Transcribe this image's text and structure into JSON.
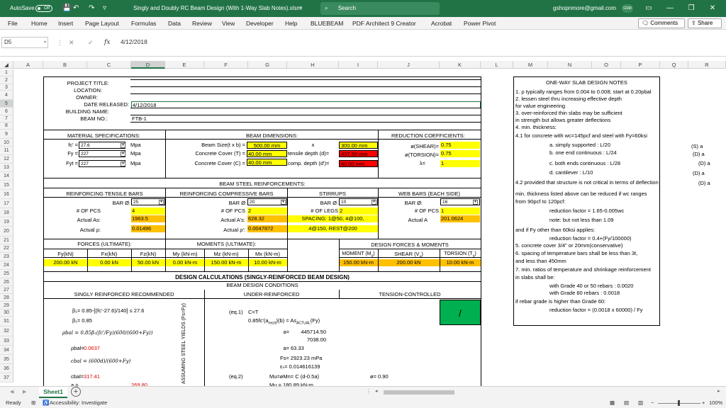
{
  "titlebar": {
    "autosave": "AutoSave",
    "toggle": "Off",
    "filename": "Singly and Doubly RC Beam Design (With 1-Way Slab Notes).xlsm",
    "search": "Search",
    "email": "gshopnmore@gmail.com",
    "avatar": "GSM"
  },
  "menu": {
    "tabs": [
      "File",
      "Home",
      "Insert",
      "Page Layout",
      "Formulas",
      "Data",
      "Review",
      "View",
      "Developer",
      "Help",
      "BLUEBEAM",
      "PDF Architect 9 Creator",
      "Acrobat",
      "Power Pivot"
    ],
    "comments": "Comments",
    "share": "Share"
  },
  "formula": {
    "namebox": "D5",
    "value": "4/12/2018"
  },
  "columns": [
    "A",
    "B",
    "C",
    "D",
    "E",
    "F",
    "G",
    "H",
    "I",
    "J",
    "K",
    "L",
    "M",
    "N",
    "O",
    "P",
    "Q",
    "R"
  ],
  "rows": [
    "1",
    "2",
    "3",
    "4",
    "5",
    "6",
    "7",
    "8",
    "9",
    "10",
    "11",
    "12",
    "13",
    "14",
    "15",
    "16",
    "17",
    "18",
    "19",
    "20",
    "21",
    "22",
    "23",
    "24",
    "25",
    "26",
    "27",
    "28",
    "29",
    "30",
    "31",
    "32",
    "33",
    "34",
    "35",
    "36",
    "37"
  ],
  "project": {
    "title": "PROJECT TITLE:",
    "location": "LOCATION:",
    "owner": "OWNER:",
    "date_label": "DATE RELEASED:",
    "date": "4/12/2018",
    "building": "BUILDING NAME:",
    "beam_label": "BEAM NO.:",
    "beam": "FTB-1"
  },
  "material": {
    "header": "MATERIAL SPECIFICATIONS:",
    "fc_label": "fc' =",
    "fc": "27.6",
    "fy_label": "Fy =",
    "fy": "227",
    "fyt_label": "Fyt =",
    "fyt": "227",
    "unit": "Mpa"
  },
  "dims": {
    "header": "BEAM DIMENSIONS:",
    "size_label": "Beam Size(t x b) =",
    "t": "500.00 mm",
    "x": "x",
    "b": "300.00 mm",
    "cover_t_label": "Concrete Cover (T) =",
    "cover_t": "40.00 mm",
    "d_label": "tensile depth (d)=",
    "d": "437.50 mm",
    "cover_c_label": "Concrete Cover (C) =",
    "cover_c": "40.00 mm",
    "dprime_label": "comp. depth (d')=",
    "dprime": "60.00 mm"
  },
  "reduction": {
    "header": "REDUCTION COEFFICIENTS:",
    "shear_label": "ø(SHEAR)=",
    "shear": "0.75",
    "torsion_label": "ø(TORSION)=",
    "torsion": "0.75",
    "lambda_label": "λ=",
    "lambda": "1"
  },
  "rebar": {
    "header": "BEAM STEEL REINFORCEMENTS:",
    "tensile": "REINFORCING TENSILE BARS",
    "compressive": "REINFORCING COMPRESSIVE BARS",
    "stirrups": "STIRRUPS",
    "web": "WEB BARS (EACH SIDE)",
    "bar_label": "BAR Ø:",
    "t_bar": "25",
    "c_bar": "20",
    "s_bar": "10",
    "w_bar": "16",
    "pcs_label": "# OF PCS",
    "t_pcs": "4",
    "c_pcs": "2",
    "legs_label": "# OF LEGS",
    "legs": "2",
    "w_pcs": "1",
    "as_label": "Actual As:",
    "as": "1963.5",
    "asp_label": "Actual A's:",
    "asp": "628.32",
    "spacing1": "SPACING: 1@50, 4@100,",
    "spacing2": "4@150, REST@200",
    "al_label": "Actual A",
    "al": "201.0624",
    "rho_label": "Actual ρ:",
    "rho": "0.01496",
    "rhop_label": "Actual ρ':",
    "rhop": "0.0047872"
  },
  "forces": {
    "f_header": "FORCES (ULTIMATE):",
    "m_header": "MOMENTS (ULTIMATE):",
    "d_header": "DESIGN FORCES & MOMENTS",
    "fy": "Fy(kN)",
    "fx": "Fx(kN)",
    "fz": "Fz(kN)",
    "my": "My (kN-m)",
    "mz": "Mz (kN-m)",
    "mx": "Mx (kN-m)",
    "fy_v": "200.00 kN",
    "fx_v": "0.00 kN",
    "fz_v": "50.00 kN",
    "my_v": "0.00 kN-m",
    "mz_v": "150.00 kN-m",
    "mx_v": "10.00 kN-m",
    "mom": "MOMENT (M",
    "shear": "SHEAR (V",
    "tor": "TORSION (T",
    "mom_v": "150.00 kN-m",
    "shear_v": "200.00 kN",
    "tor_v": "10.00 kN-m"
  },
  "calc": {
    "title": "DESIGN CALCULATIONS (SINGLY-REINFORCED BEAM DESIGN)",
    "conditions": "BEAM DESIGN CONDITIONS",
    "singly": "SINGLY REINFORCED RECOMMENDED",
    "under": "UNDER-REINFORCED",
    "tension": "TENSION-CONTROLLED",
    "check": "/",
    "b1_formula": "β₁= 0.85-[(fc'-27.6)/140] ≤ 27.6",
    "b1": "β₁= 0.85",
    "pbal_formula": "ρbal = 0.85β₁(fc'/Fy)(600/(600+Fy))",
    "pbal_label": "ρbal=",
    "pbal": "0.0637",
    "cbal_formula": "cbal = (600d)/(600+Fy)",
    "cbal_label": "cbal=",
    "cbal": "317.41",
    "row37_label": "a =",
    "row37": "269.80",
    "vertical": "ASSUMING STEEL YIELDS (Fs=Fy)",
    "eq1": "(eq.1)",
    "cet": "C=T",
    "eq1b": "0.85fc'(a",
    "eq1c": ")(b) = As",
    "eq1d": "(Fy)",
    "a_label": "a=",
    "a1": "445714.50",
    "a2": "7038.00",
    "a3": "63.33",
    "fs": "Fs= 2923.23 mPa",
    "es": "εₛ= 0.014616139",
    "eq2": "(eq.2)",
    "mu": "Mu=øMn= C (d-0.5a)",
    "phi": "ø= 0.90",
    "mu2": "Mu = 180.89 kN-m"
  },
  "notes": {
    "header": "ONE-WAY SLAB DESIGN NOTES",
    "lines": [
      "1. ρ typically ranges from 0.004 to 0.008; start at 0.20pbal",
      "2. lessen steel thru increasing effective depth",
      "for value engineering",
      "3. over-reinforced thin slabs may be sufficient",
      "in strength but allows greater deflections",
      "4. min. thickness:",
      "4.1 for concrete with wc=145pcf and steel with Fy=60ksi",
      "a. simply supported : L/20",
      "b. one end continuous : L/24",
      "c. both ends continuous : L/28",
      "d. cantilever : L/10",
      "4.2 provided that structure is not critical in terms of deflection,",
      "min. thickness listed above can be reduced if wc ranges",
      "from 90pcf to 120pcf:",
      "reduction factor = 1.65-0.005wc",
      "note: but not less than 1.09",
      "and if Fy other than 60ksi applies:",
      "reduction factor = 0.4+(Fy/100000)",
      "5. concrete cover 3/4\" or 20mm(conservative)",
      "6. spacing of temperature bars shall be less than 3t,",
      "and less than 450mm",
      "7. min. ratios of temperature and shrinkage reinforcement",
      "in slabs shall be:",
      "with Grade 40 or 50 rebars : 0.0020",
      "with Grade 60 rebars : 0.0018",
      "if rebar grade is higher than Grade 60:",
      "reduction factor = (0.0018 x 60000) / Fy"
    ],
    "side": [
      "(S) a",
      "(D) a",
      "(D) a",
      "(D) a",
      "(D) a"
    ]
  },
  "sheet": {
    "tab": "Sheet1",
    "add": "+"
  },
  "status": {
    "ready": "Ready",
    "access": "Accessibility: Investigate",
    "zoom": "100%"
  }
}
